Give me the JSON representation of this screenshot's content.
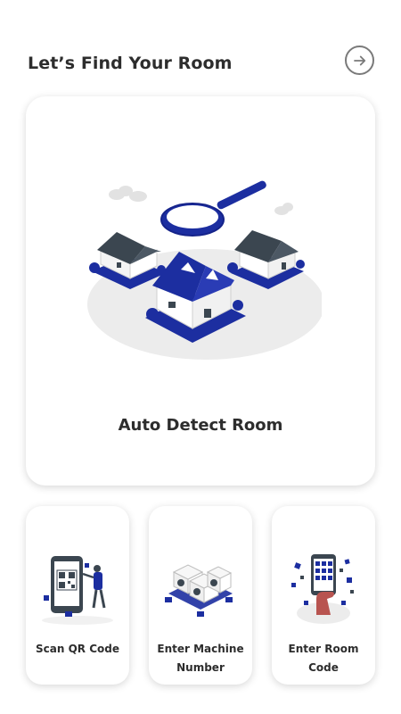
{
  "header": {
    "title": "Let’s Find Your Room",
    "next_icon": "arrow-right-circle-icon"
  },
  "main_card": {
    "label": "Auto Detect Room",
    "illustration": "houses-with-magnifier-illustration"
  },
  "options": [
    {
      "label": "Scan QR Code",
      "illustration": "qr-scan-illustration"
    },
    {
      "label": "Enter Machine Number",
      "illustration": "washing-machines-illustration"
    },
    {
      "label": "Enter Room Code",
      "illustration": "phone-keypad-illustration"
    }
  ],
  "colors": {
    "accent": "#1c2ea0",
    "text": "#2d2d2d",
    "icon_gray": "#7a7a7a",
    "card_bg": "#ffffff"
  }
}
